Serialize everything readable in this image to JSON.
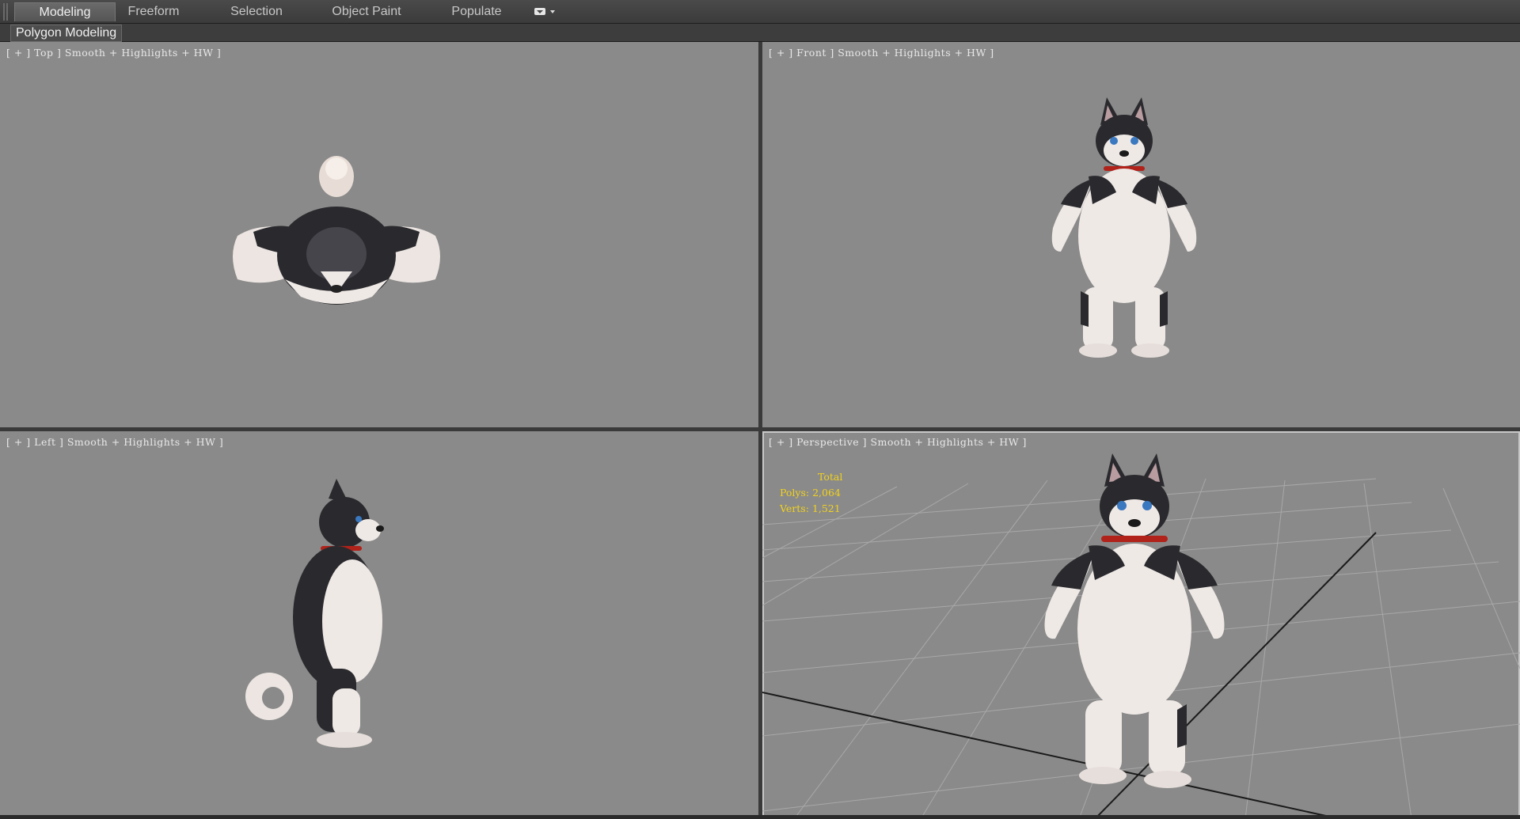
{
  "ribbon": {
    "tabs": [
      {
        "label": "Modeling",
        "active": true
      },
      {
        "label": "Freeform",
        "active": false
      },
      {
        "label": "Selection",
        "active": false
      },
      {
        "label": "Object Paint",
        "active": false
      },
      {
        "label": "Populate",
        "active": false
      }
    ],
    "options_icon": "ribbon-options-icon",
    "panel_label": "Polygon Modeling"
  },
  "viewports": {
    "top": {
      "label": "[ + ] Top ] Smooth + Highlights + HW ]"
    },
    "front": {
      "label": "[ + ] Front ] Smooth + Highlights + HW ]"
    },
    "left": {
      "label": "[ + ] Left ] Smooth + Highlights + HW ]"
    },
    "perspective": {
      "label": "[ + ] Perspective ] Smooth + Highlights + HW ]"
    }
  },
  "stats": {
    "title": "Total",
    "polys_label": "Polys:",
    "polys_value": "2,064",
    "verts_label": "Verts:",
    "verts_value": "1,521"
  },
  "colors": {
    "viewport_bg": "#8a8a8a",
    "stats_text": "#f2d21c",
    "fur_dark": "#2a2a2e",
    "fur_light": "#efe9e6",
    "collar": "#b0221a"
  }
}
